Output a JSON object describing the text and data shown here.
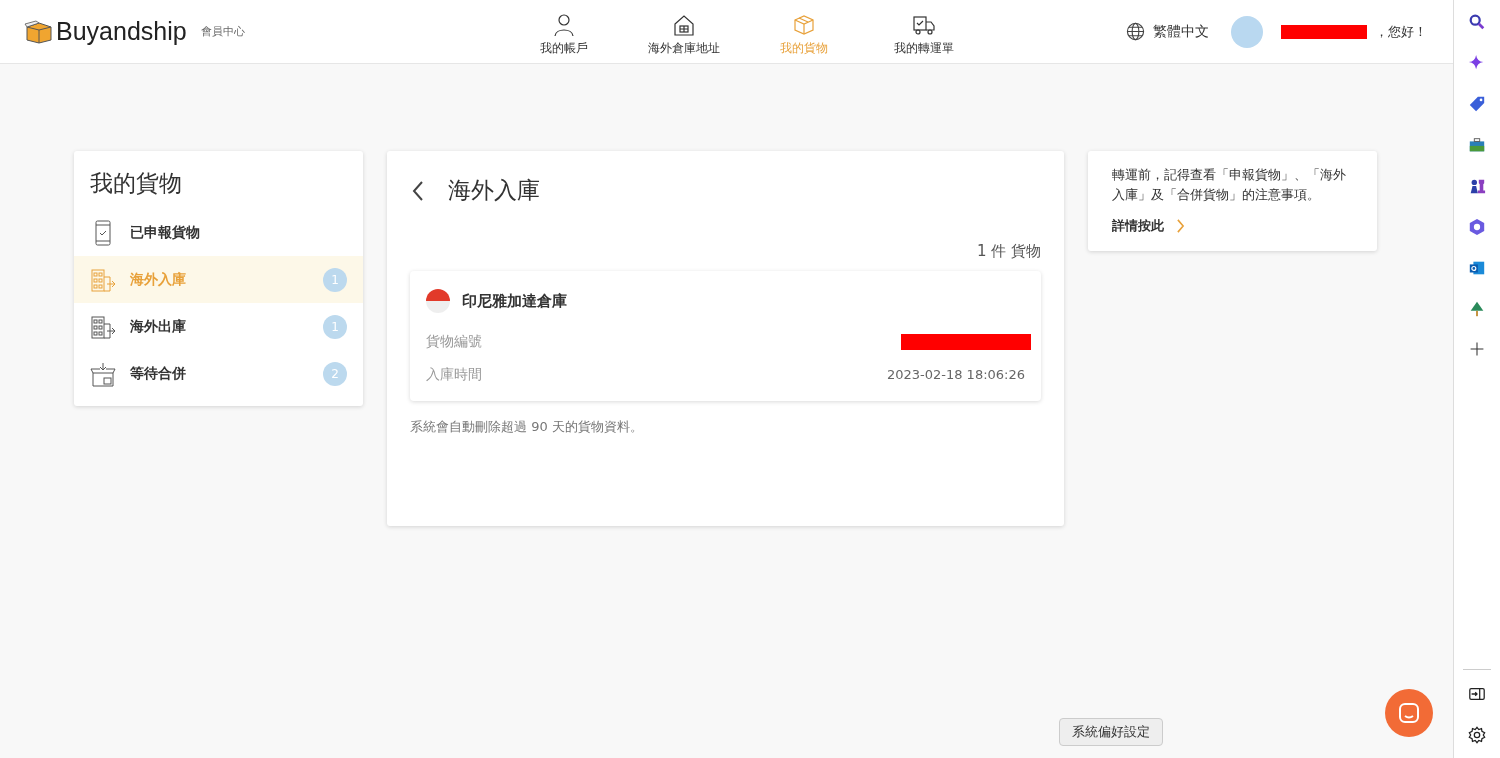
{
  "header": {
    "logo": "Buyandship",
    "subtitle": "會員中心",
    "nav": [
      {
        "label": "我的帳戶",
        "kind": "person",
        "selected": false
      },
      {
        "label": "海外倉庫地址",
        "kind": "house",
        "selected": false
      },
      {
        "label": "我的貨物",
        "kind": "box",
        "selected": true
      },
      {
        "label": "我的轉運單",
        "kind": "truck",
        "selected": false
      }
    ],
    "language": "繁體中文",
    "greeting": "，您好！"
  },
  "sidebar": {
    "title": "我的貨物",
    "items": [
      {
        "label": "已申報貨物",
        "kind": "phone",
        "selected": false
      },
      {
        "label": "海外入庫",
        "kind": "inbound",
        "selected": true,
        "count": "1"
      },
      {
        "label": "海外出庫",
        "kind": "outbound",
        "selected": false,
        "count": "1"
      },
      {
        "label": "等待合併",
        "kind": "package",
        "selected": false,
        "count": "2"
      }
    ]
  },
  "main": {
    "title": "海外入庫",
    "summary": "1 件 貨物",
    "warehouse": {
      "name": "印尼雅加達倉庫",
      "rows": [
        {
          "label": "貨物編號",
          "kind": "redacted"
        },
        {
          "label": "入庫時間",
          "kind": "text",
          "value": "2023-02-18 18:06:26"
        }
      ]
    },
    "note": "系統會自動刪除超過 90 天的貨物資料。"
  },
  "info": {
    "text": "轉運前，記得查看「申報貨物」、「海外入庫」及「合併貨物」的注意事項。",
    "link": "詳情按此"
  },
  "tooltip": "系統偏好設定"
}
